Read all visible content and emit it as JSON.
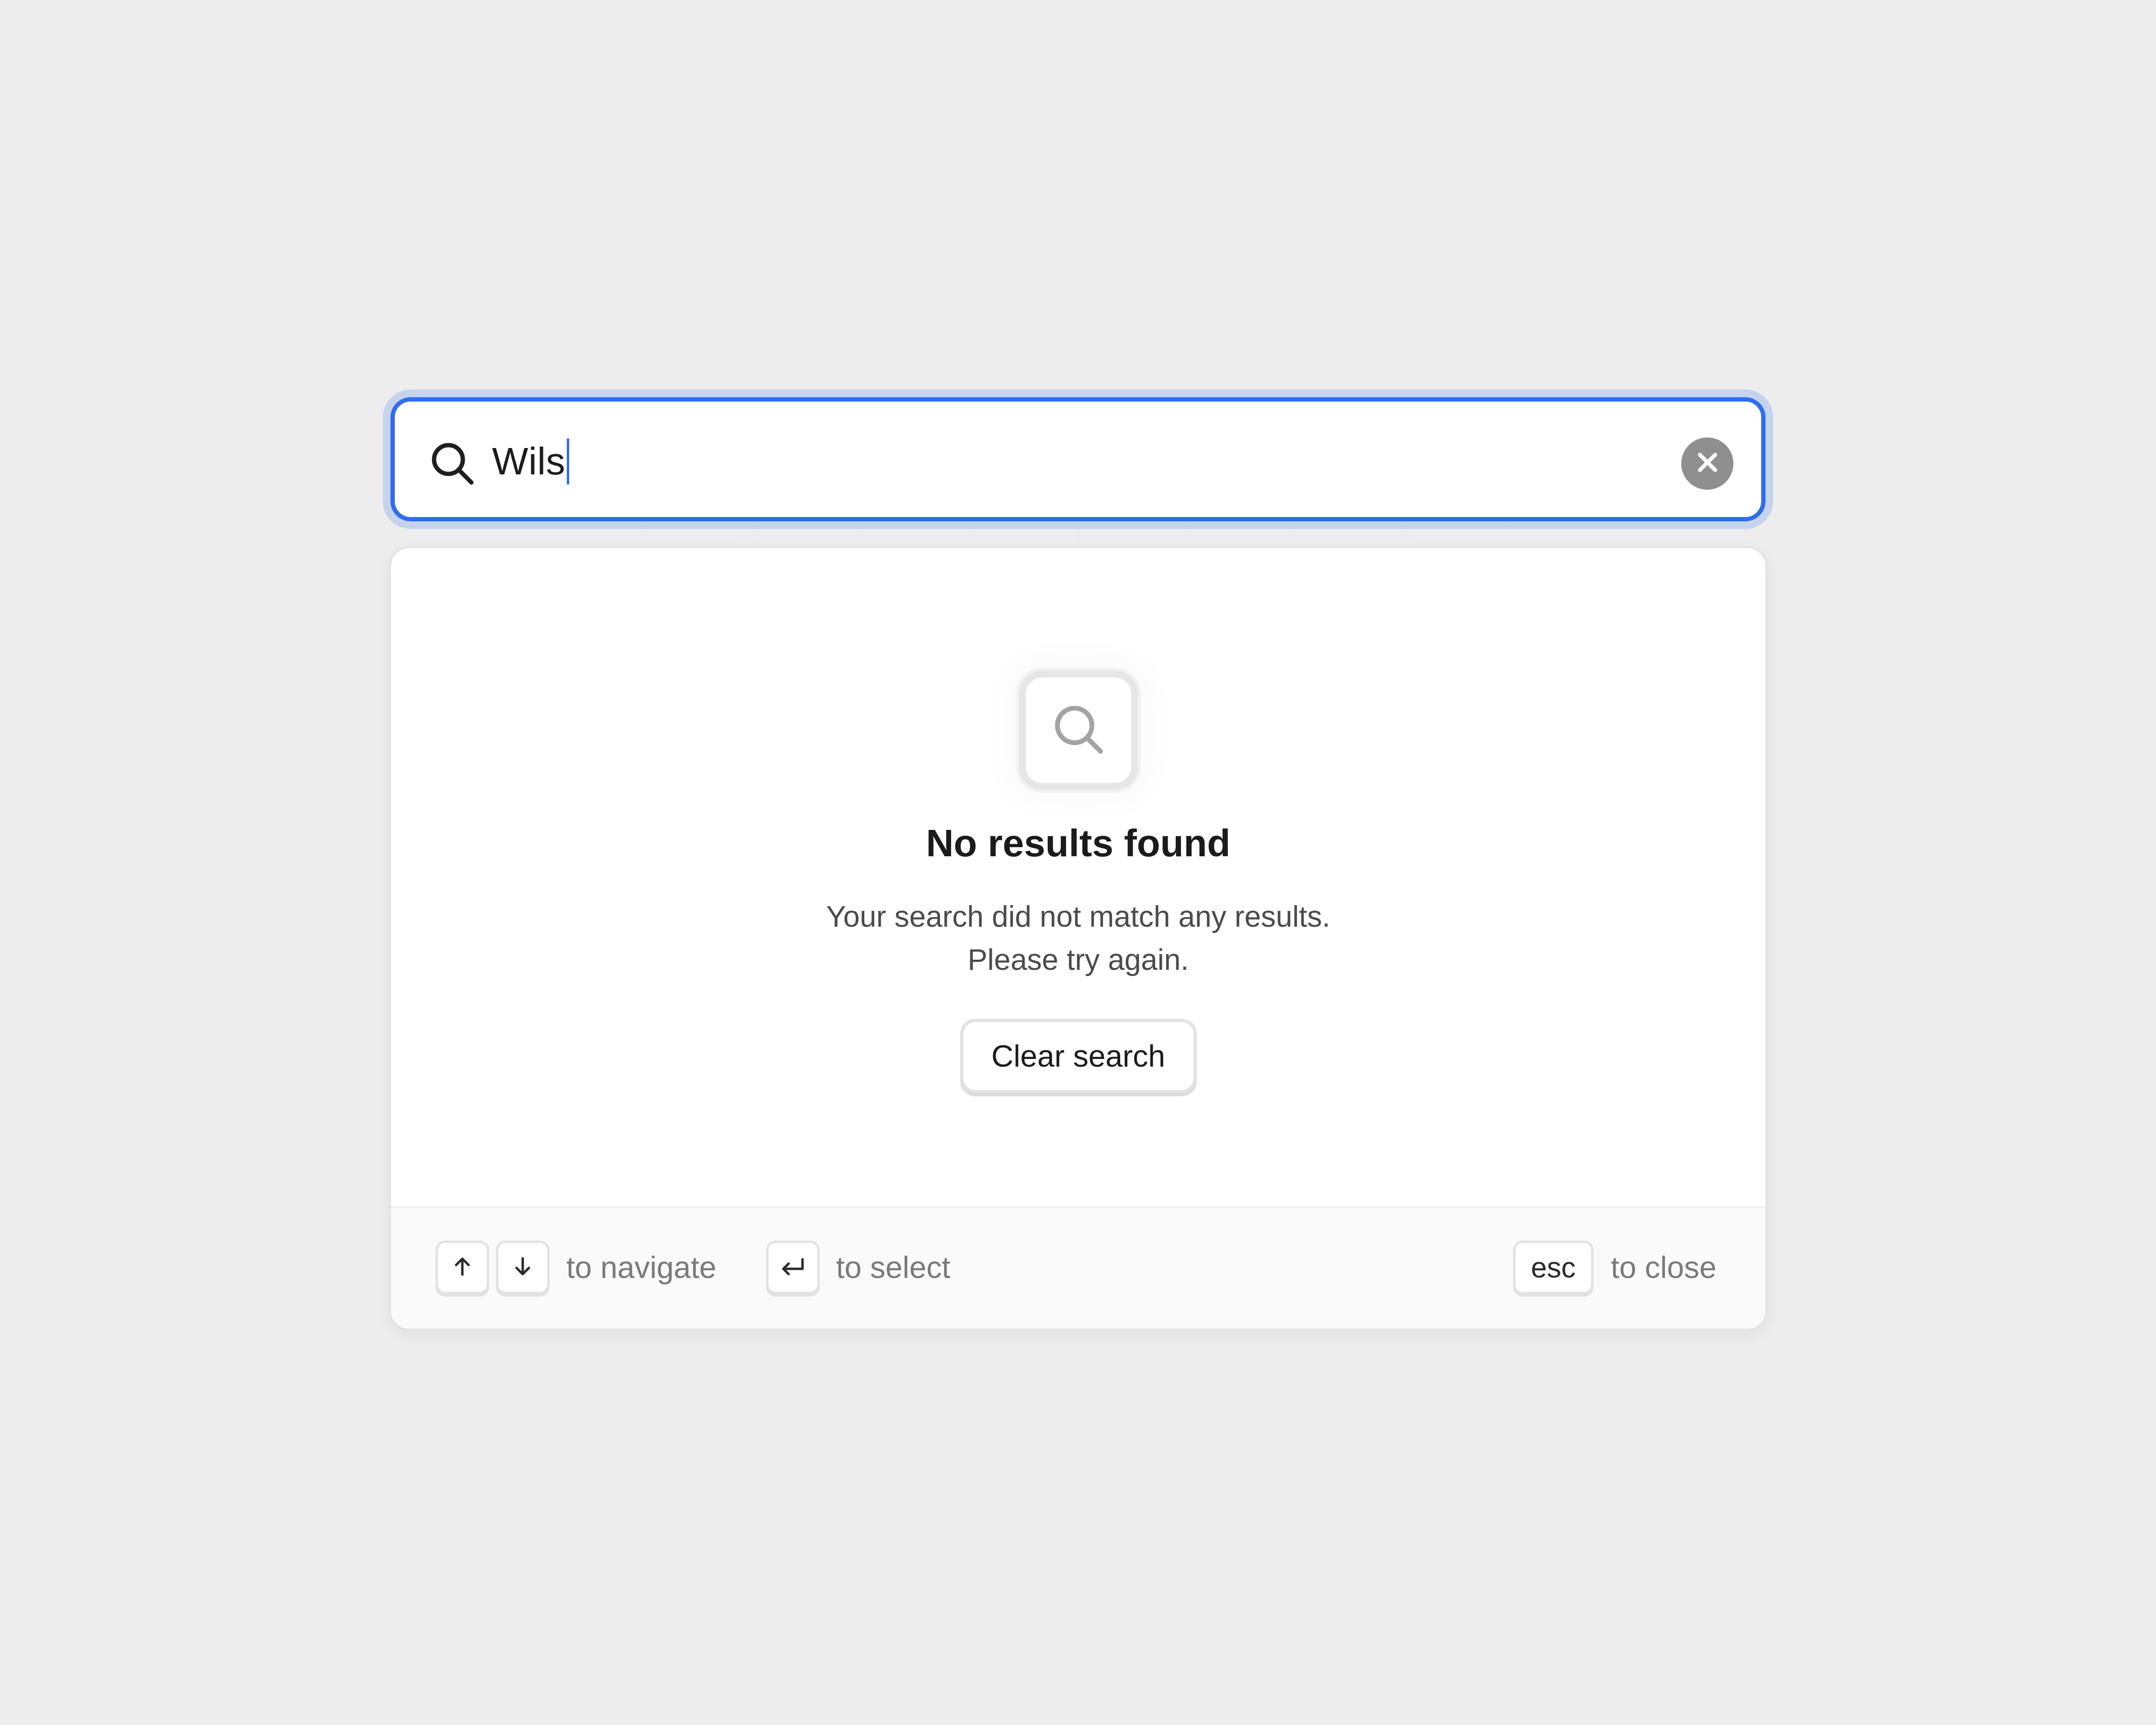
{
  "search": {
    "value": "Wils",
    "clear_icon": "close-icon",
    "accent_color": "#2f6cf0"
  },
  "empty_state": {
    "icon": "search-icon",
    "title": "No results found",
    "message_line1": "Your search did not match any results.",
    "message_line2": "Please try again.",
    "clear_button_label": "Clear search"
  },
  "footer": {
    "navigate_keys": [
      "arrow-up-icon",
      "arrow-down-icon"
    ],
    "navigate_label": "to navigate",
    "select_key": "enter-icon",
    "select_label": "to select",
    "close_key": "esc",
    "close_label": "to close"
  }
}
